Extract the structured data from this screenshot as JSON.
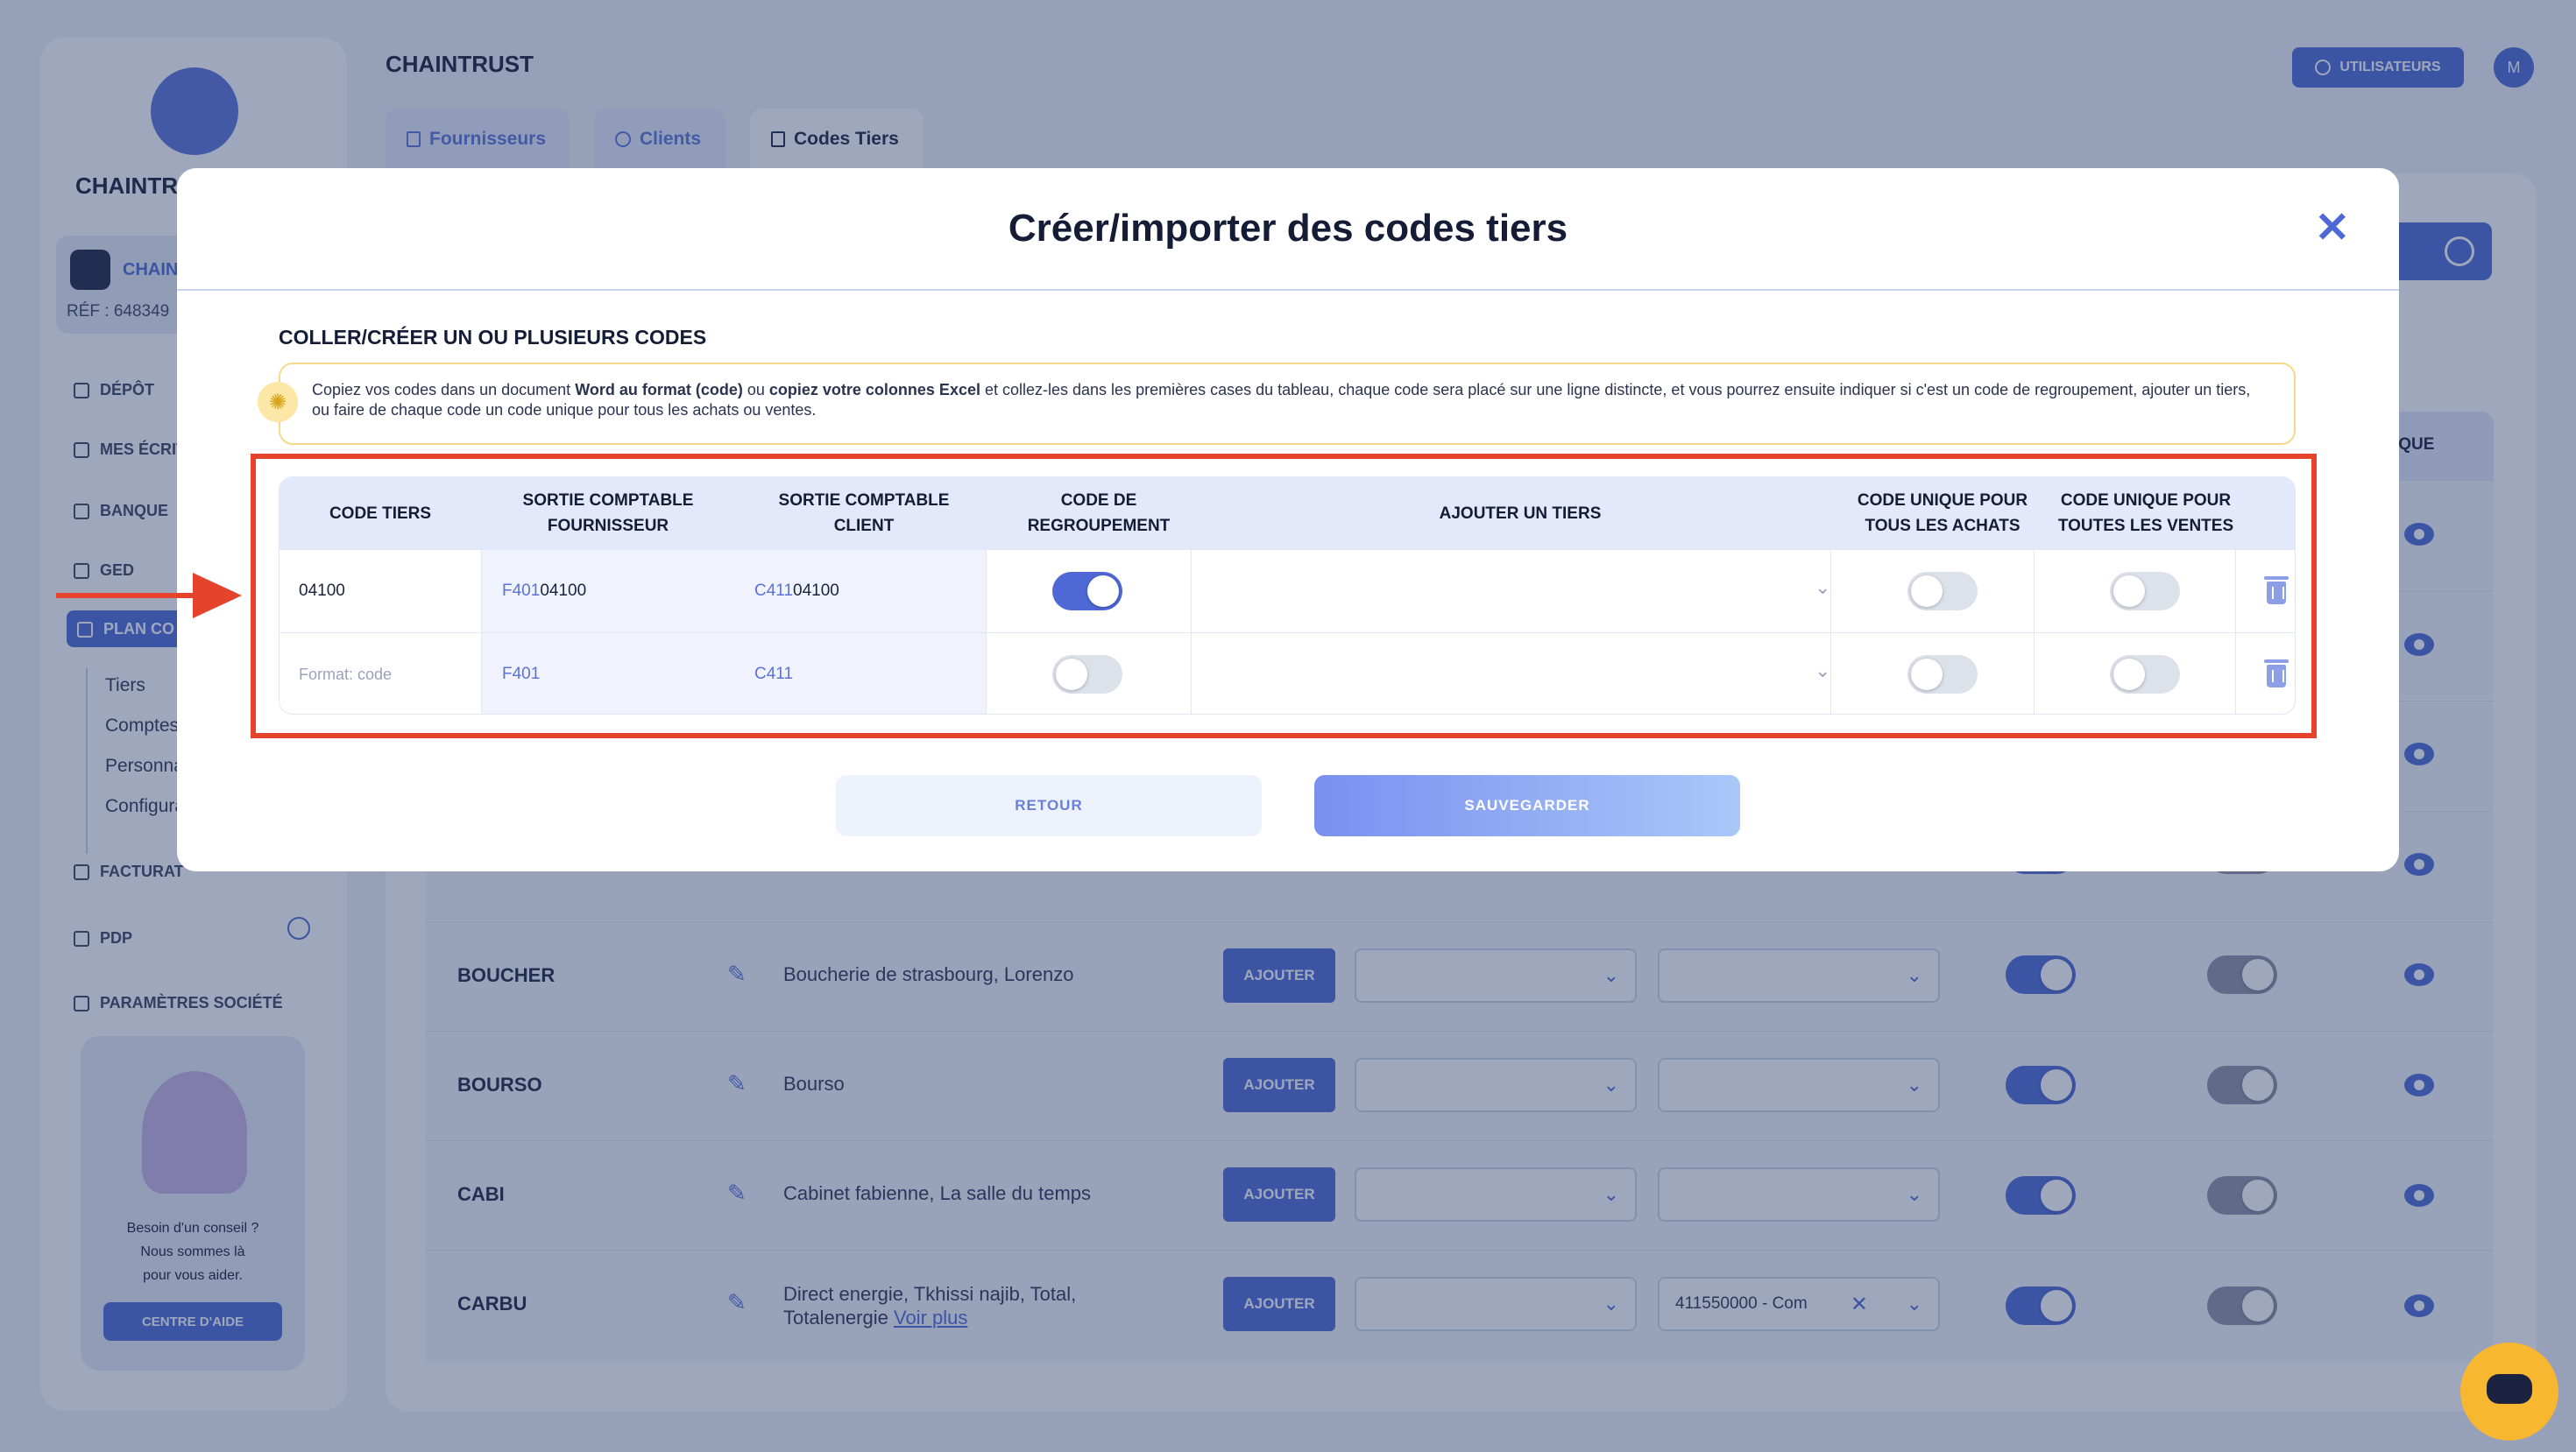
{
  "brand": {
    "name": "CHAINTRUST",
    "short": "CHAINTR",
    "company": "CHAINT",
    "ref": "RÉF : 648349"
  },
  "sidebar": {
    "items": [
      {
        "label": "DÉPÔT",
        "icon": "upload-icon"
      },
      {
        "label": "MES ÉCRIT",
        "icon": "document-icon"
      },
      {
        "label": "BANQUE",
        "icon": "bank-icon"
      },
      {
        "label": "GED",
        "icon": "folder-icon"
      },
      {
        "label": "PLAN CO",
        "icon": "chart-icon"
      },
      {
        "label": "FACTURAT",
        "icon": "invoice-icon"
      },
      {
        "label": "PDP",
        "icon": "card-icon"
      },
      {
        "label": "PARAMÈTRES SOCIÉTÉ",
        "icon": "sliders-icon"
      }
    ],
    "subitems": [
      "Tiers",
      "Comptes",
      "Personna",
      "Configura"
    ],
    "help": {
      "line1": "Besoin d'un conseil ?",
      "line2": "Nous sommes là",
      "line3": "pour vous aider.",
      "button": "CENTRE D'AIDE"
    }
  },
  "header": {
    "title": "CHAINTRUST",
    "users_button": "UTILISATEURS",
    "avatar": "M"
  },
  "tabs": [
    {
      "label": "Fournisseurs",
      "icon": "building-icon"
    },
    {
      "label": "Clients",
      "icon": "users-icon"
    },
    {
      "label": "Codes Tiers",
      "icon": "list-icon"
    }
  ],
  "background_table": {
    "col_fragment": "IQUE",
    "add_label": "AJOUTER",
    "rows": [
      {
        "code": "BOUCHER",
        "names": "Boucherie de strasbourg, Lorenzo",
        "more": "",
        "client": ""
      },
      {
        "code": "BOURSO",
        "names": "Bourso",
        "more": "",
        "client": ""
      },
      {
        "code": "CABI",
        "names": "Cabinet fabienne, La salle du temps",
        "more": "",
        "client": ""
      },
      {
        "code": "CARBU",
        "names": "Direct energie, Tkhissi najib, Total, Totalenergie",
        "more": "Voir plus",
        "client": "411550000 - Com"
      }
    ]
  },
  "modal": {
    "title": "Créer/importer des codes tiers",
    "section_title": "COLLER/CRÉER UN OU PLUSIEURS CODES",
    "info": {
      "p1": "Copiez vos codes dans un document ",
      "b1": "Word au format (code)",
      "p2": " ou ",
      "b2": "copiez votre colonnes Excel",
      "p3": " et collez-les dans les premières cases du tableau, chaque code sera placé sur une ligne distincte, et vous pourrez ensuite indiquer si c'est un code de regroupement, ajouter un tiers, ou faire de chaque code un code unique pour tous les achats ou ventes."
    },
    "columns": [
      "CODE TIERS",
      "SORTIE COMPTABLE FOURNISSEUR",
      "SORTIE COMPTABLE CLIENT",
      "CODE DE REGROUPEMENT",
      "AJOUTER UN TIERS",
      "CODE UNIQUE POUR TOUS LES ACHATS",
      "CODE UNIQUE POUR TOUTES LES VENTES"
    ],
    "rows": [
      {
        "code": "04100",
        "placeholder": "",
        "supplier_prefix": "F401",
        "supplier_suffix": "04100",
        "client_prefix": "C411",
        "client_suffix": "04100",
        "grouping": true,
        "unique_purchases": false,
        "unique_sales": false
      },
      {
        "code": "",
        "placeholder": "Format: code",
        "supplier_prefix": "F401",
        "supplier_suffix": "",
        "client_prefix": "C411",
        "client_suffix": "",
        "grouping": false,
        "unique_purchases": false,
        "unique_sales": false
      }
    ],
    "back_button": "RETOUR",
    "save_button": "SAUVEGARDER"
  },
  "colors": {
    "accent": "#4e68d6",
    "highlight": "#e6432c",
    "chat": "#f7b731"
  }
}
